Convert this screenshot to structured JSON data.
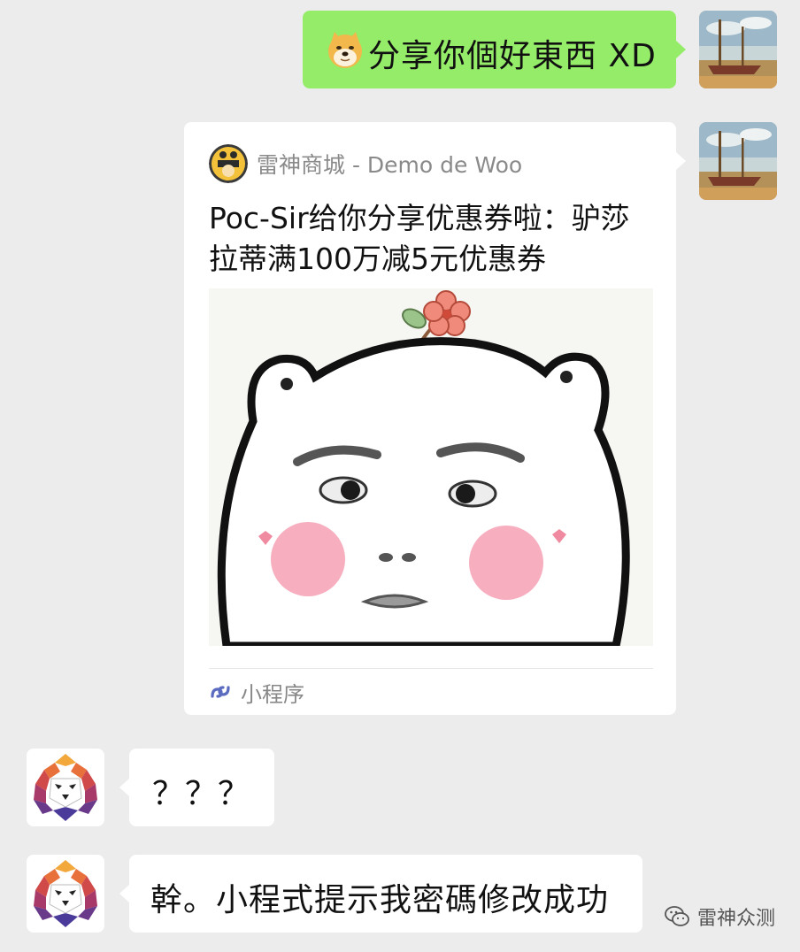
{
  "messages": [
    {
      "id": "m1",
      "side": "right",
      "type": "text",
      "emoji": "doge-emoji",
      "text": "分享你個好東西 XD"
    },
    {
      "id": "m2",
      "side": "right",
      "type": "mini_program",
      "source": "雷神商城 - Demo de Woo",
      "title": "Poc-Sir给你分享优惠券啦：驴莎拉蒂满100万减5元优惠券",
      "footer_label": "小程序"
    },
    {
      "id": "m3",
      "side": "left",
      "type": "text",
      "text": "？？？"
    },
    {
      "id": "m4",
      "side": "left",
      "type": "text",
      "text": "幹。小程式提示我密碼修改成功"
    }
  ],
  "watermark": {
    "text": "雷神众测"
  },
  "colors": {
    "background": "#ececec",
    "sent_bubble": "#95ec69",
    "received_bubble": "#ffffff"
  }
}
